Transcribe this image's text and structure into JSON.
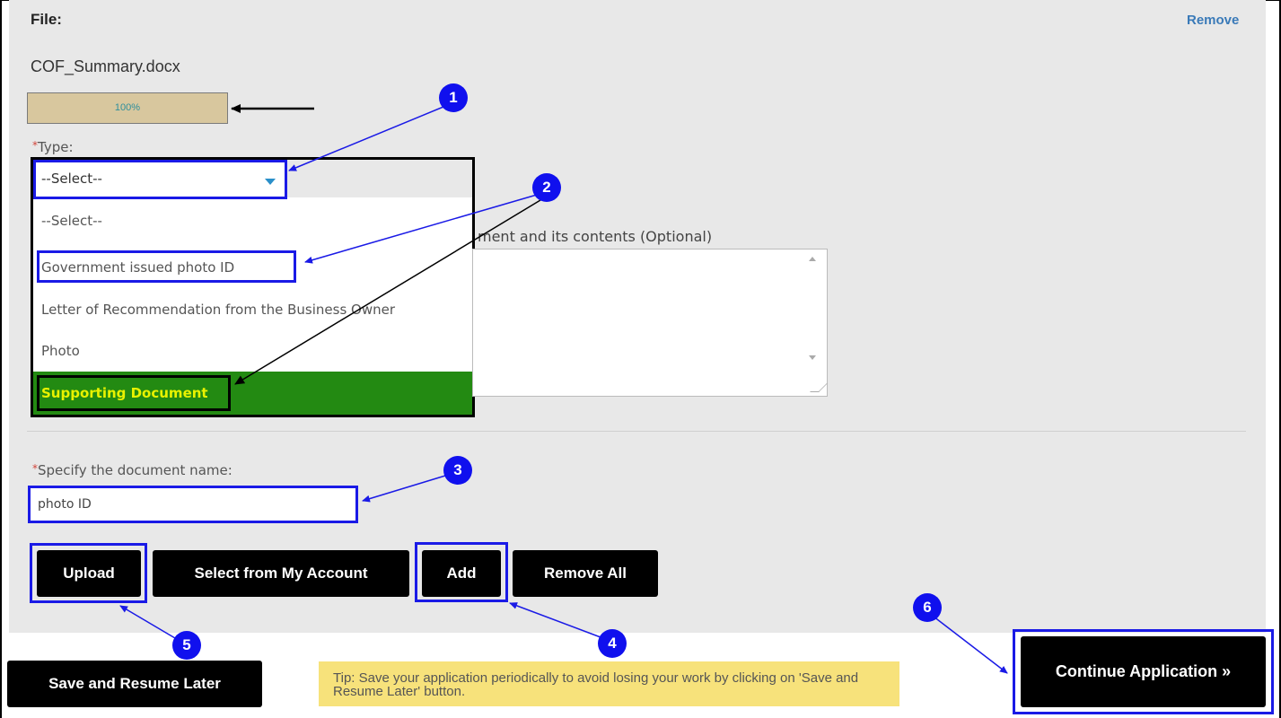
{
  "file": {
    "label": "File:",
    "remove_label": "Remove",
    "name": "COF_Summary.docx",
    "progress": {
      "percent": 100,
      "text": "100%"
    }
  },
  "type_field": {
    "required_mark": "*",
    "label": "Type:",
    "selected": "--Select--",
    "options": [
      "--Select--",
      "Government issued photo ID",
      "Letter of Recommendation from the Business Owner",
      "Photo",
      "Supporting Document"
    ],
    "highlighted_option": "Supporting Document"
  },
  "description_field": {
    "label_visible": "ment and its contents (Optional)",
    "value": ""
  },
  "docname_field": {
    "required_mark": "*",
    "label": "Specify the document name:",
    "value": "photo ID"
  },
  "actions": {
    "upload": "Upload",
    "select_from_account": "Select from My Account",
    "add": "Add",
    "remove_all": "Remove All"
  },
  "footer": {
    "save_resume": "Save and Resume Later",
    "tip": "Tip: Save your application periodically to avoid losing your work by clicking on 'Save and Resume Later' button.",
    "continue": "Continue Application »"
  },
  "callouts": [
    "1",
    "2",
    "3",
    "4",
    "5",
    "6"
  ],
  "colors": {
    "highlight_border": "#1a1ae6",
    "badge": "#1010ee",
    "selected_option_bg": "#238a12",
    "selected_option_text": "#e8f200",
    "progress_bg": "#d8c79e",
    "tip_bg": "#f7e27b",
    "link": "#3a7ab8"
  }
}
